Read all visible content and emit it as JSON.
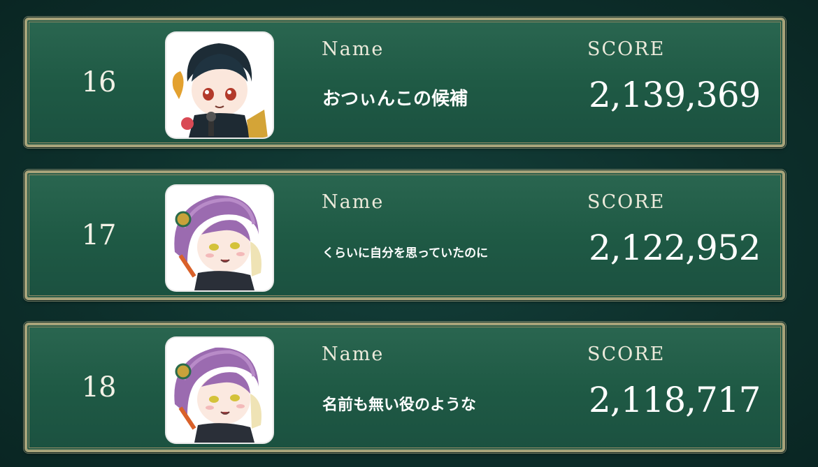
{
  "labels": {
    "name": "Name",
    "score": "SCORE"
  },
  "entries": [
    {
      "rank": "16",
      "name": "おつぃんこの候補",
      "score": "2,139,369",
      "avatar": "dark-haired-chibi-avatar"
    },
    {
      "rank": "17",
      "name": "くらいに自分を思っていたのに",
      "score": "2,122,952",
      "avatar": "purple-haired-chibi-avatar"
    },
    {
      "rank": "18",
      "name": "名前も無い役のような",
      "score": "2,118,717",
      "avatar": "purple-haired-chibi-avatar"
    }
  ],
  "colors": {
    "card": "#1f5a45",
    "border": "#a7a37a",
    "background": "#0d2f2b",
    "text": "#ffffff"
  }
}
